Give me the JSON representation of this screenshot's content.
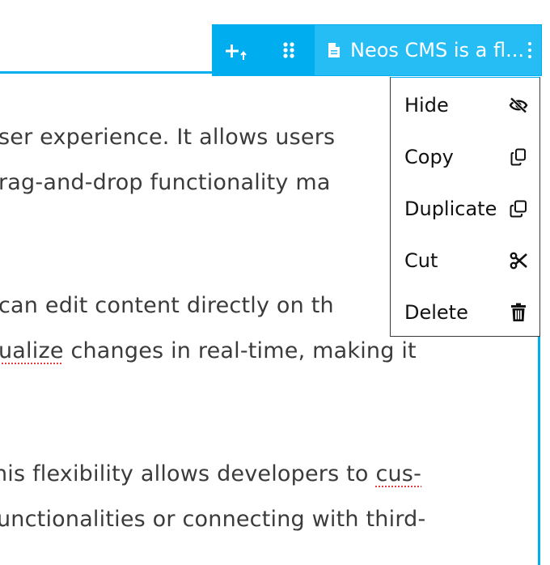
{
  "toolbar": {
    "add_icon": "plus-with-up-arrow-icon",
    "drag_icon": "drag-handle-icon",
    "node_label": "Neos CMS is a fl...",
    "node_icon": "document-icon",
    "more_icon": "kebab-menu-icon"
  },
  "menu": {
    "items": [
      {
        "label": "Hide",
        "icon": "eye-slash-icon"
      },
      {
        "label": "Copy",
        "icon": "copy-icon"
      },
      {
        "label": "Duplicate",
        "icon": "duplicate-icon"
      },
      {
        "label": "Cut",
        "icon": "scissors-icon"
      },
      {
        "label": "Delete",
        "icon": "trash-icon"
      }
    ]
  },
  "content": {
    "lines": [
      "ser experience. It allows users",
      "rag-and-drop functionality ma",
      "can edit content directly on th",
      "changes in real-time, making it",
      "his flexibility allows developers to",
      "unctionalities or connecting with third-"
    ],
    "spellcheck_words": [
      "ualize",
      "cus-"
    ]
  },
  "colors": {
    "accent": "#00adee",
    "accent_light": "#26bdf4",
    "text": "#3b3b3b"
  }
}
